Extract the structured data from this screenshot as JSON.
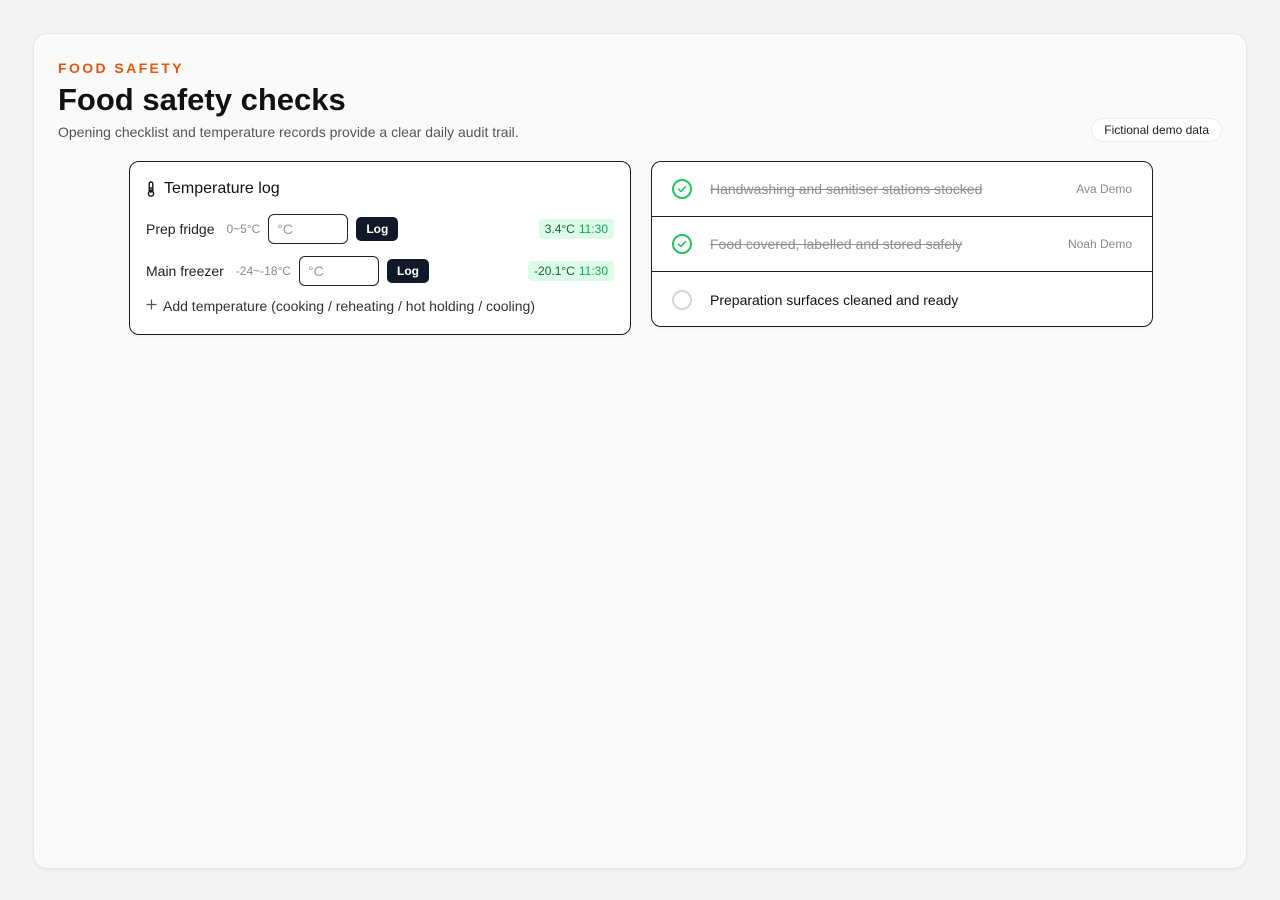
{
  "header": {
    "eyebrow": "FOOD SAFETY",
    "title": "Food safety checks",
    "subtitle": "Opening checklist and temperature records provide a clear daily audit trail.",
    "badge": "Fictional demo data"
  },
  "temperature_log": {
    "title": "Temperature log",
    "icon": "thermometer-icon",
    "rows": [
      {
        "name": "Prep fridge",
        "range": "0~5°C",
        "placeholder": "°C",
        "button": "Log",
        "reading": "3.4°C",
        "time": "11:30"
      },
      {
        "name": "Main freezer",
        "range": "-24~-18°C",
        "placeholder": "°C",
        "button": "Log",
        "reading": "-20.1°C",
        "time": "11:30"
      }
    ],
    "add_label": "Add temperature (cooking / reheating / hot holding / cooling)"
  },
  "checklist": {
    "items": [
      {
        "label": "Handwashing and sanitiser stations stocked",
        "done": true,
        "by": "Ava Demo"
      },
      {
        "label": "Food covered, labelled and stored safely",
        "done": true,
        "by": "Noah Demo"
      },
      {
        "label": "Preparation surfaces cleaned and ready",
        "done": false,
        "by": ""
      }
    ]
  },
  "colors": {
    "accent": "#e8550c",
    "success": "#22c55e",
    "button": "#111827"
  }
}
